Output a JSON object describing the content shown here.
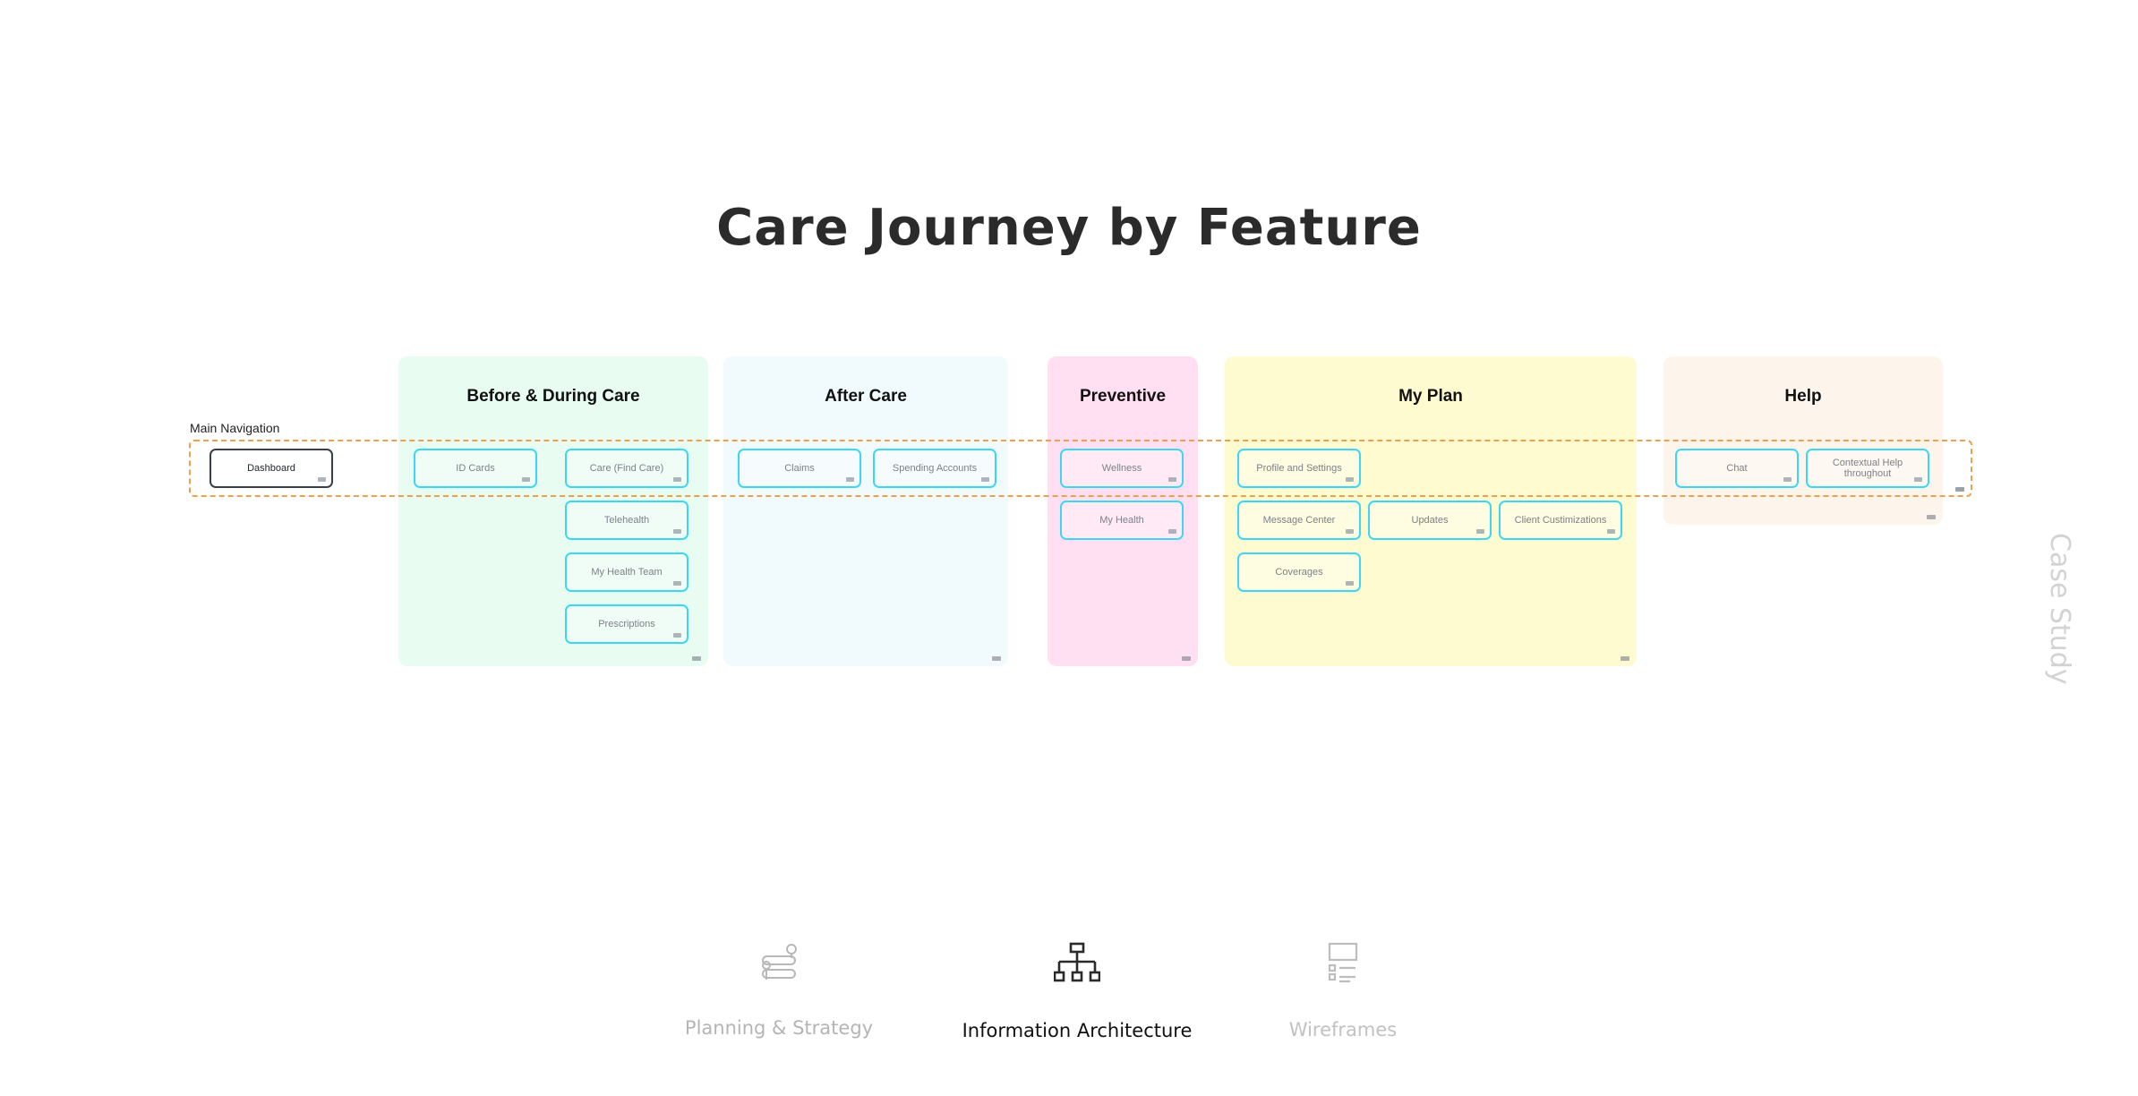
{
  "title": "Care Journey by Feature",
  "main_navigation_label": "Main Navigation",
  "dashboard": "Dashboard",
  "side_label": "Case Study",
  "colors": {
    "before_during": "#e8fcf2",
    "after": "#f1fbfd",
    "preventive": "#ffdff1",
    "my_plan": "#fefbd1",
    "help": "#fdf5ec",
    "box_border": "#3ad8f6",
    "nav_band": "#f0a04b"
  },
  "columns": {
    "before_during": {
      "title": "Before & During Care",
      "items": [
        "ID Cards",
        "Care (Find Care)",
        "Telehealth",
        "My Health Team",
        "Prescriptions"
      ]
    },
    "after": {
      "title": "After Care",
      "items": [
        "Claims",
        "Spending Accounts"
      ]
    },
    "preventive": {
      "title": "Preventive",
      "items": [
        "Wellness",
        "My Health"
      ]
    },
    "my_plan": {
      "title": "My Plan",
      "items": [
        "Profile and Settings",
        "Message Center",
        "Updates",
        "Client Custimizations",
        "Coverages"
      ]
    },
    "help": {
      "title": "Help",
      "items": [
        "Chat",
        "Contextual Help throughout"
      ]
    }
  },
  "bottom_nav": [
    {
      "label": "Planning & Strategy",
      "icon": "route-map-icon",
      "active": false
    },
    {
      "label": "Information Architecture",
      "icon": "sitemap-icon",
      "active": true
    },
    {
      "label": "Wireframes",
      "icon": "wireframe-icon",
      "active": false
    }
  ]
}
